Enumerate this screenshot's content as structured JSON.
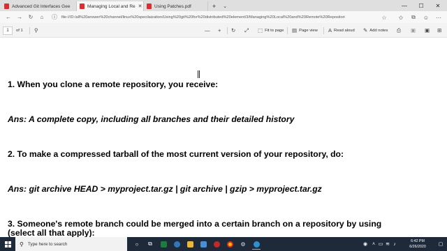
{
  "browser": {
    "tabs": [
      {
        "label": "Advanced Git Interfaces Gee"
      },
      {
        "label": "Managing Local and Re"
      },
      {
        "label": "Using Patches.pdf"
      }
    ],
    "new_tab": "+",
    "tab_dropdown": "⌄",
    "window_controls": {
      "minimize": "—",
      "maximize": "☐",
      "close": "✕"
    },
    "url": "file:///D:/all%20answer%20channel/linux%20specilaization/Using%20git%20for%20distributed%20element/3/Managing%20Local%20and%20Remote%20Repositori"
  },
  "pdf_toolbar": {
    "page_number": "1",
    "page_total": "of 1",
    "fit_to_page": "Fit to page",
    "page_view": "Page view",
    "read_aloud": "Read aloud",
    "add_notes": "Add notes"
  },
  "document": {
    "q1": "1. When you clone a remote repository, you receive:",
    "a1": "Ans: A complete copy, including all branches and their detailed history",
    "q2": "2. To make a compressed tarball of the most current version of your repository, do:",
    "a2": "Ans: git archive HEAD > myproject.tar.gz | git archive | gzip > myproject.tar.gz",
    "q3_line1": "3. Someone's remote branch could be merged into a certain branch on a repository by using",
    "q3_line2": "(select all that apply):"
  },
  "taskbar": {
    "search_placeholder": "Type here to search",
    "time": "6:42 PM",
    "date": "6/26/2020"
  }
}
